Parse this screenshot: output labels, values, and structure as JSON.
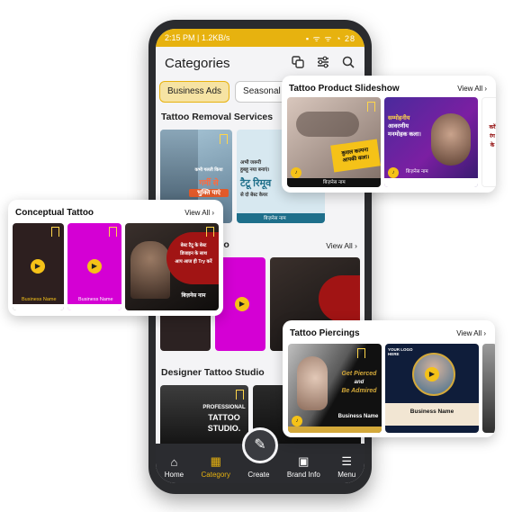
{
  "status": {
    "time": "2:15 PM | 1.2KB/s",
    "icons": "▪ ᯤ ᯤ ◔ 28"
  },
  "appbar": {
    "title": "Categories"
  },
  "chips": [
    "Business Ads",
    "Seasonal B"
  ],
  "sections": {
    "removal": "Tattoo Removal Services",
    "conceptual_partial": "ttoo",
    "designer": "Designer Tattoo Studio",
    "view_all": "View All"
  },
  "removal_posters": {
    "p1_line1": "कभी गलती किया",
    "p1_line2": "गर्मी से",
    "p1_line3": "भुक्ति पाएं",
    "p2_line1": "अभी जरूरी",
    "p2_line2": "हुबहू नया बनाएं।",
    "p2_line3": "टैटू रिमूव",
    "p2_line4": "से दो बेस्ट केयर",
    "p2_footer": "बिज़नेस नाम"
  },
  "designer_poster": {
    "line1": "PROFESSIONAL",
    "line2": "TATTOO",
    "line3": "STUDIO."
  },
  "bottom_nav": {
    "home": "Home",
    "category": "Category",
    "create": "Create",
    "brand": "Brand Info",
    "menu": "Menu"
  },
  "card_slideshow": {
    "title": "Tattoo Product Slideshow",
    "view_all": "View All",
    "p1_line1": "कुशल कल्पना",
    "p1_line2": "आपकी कला।",
    "p1_footer": "बिज़नेस नाम",
    "p2_line1": "सम्मोहनीय",
    "p2_line2": "आवरणीय",
    "p2_line3": "मनमोहक कला।",
    "p2_footer": "बिज़नेस नाम",
    "p3_line1": "करें",
    "p3_line2": "रंग",
    "p3_line3": "के"
  },
  "card_conceptual": {
    "title": "Conceptual Tattoo",
    "view_all": "View All",
    "p1_name": "Business Name",
    "p2_name": "Business Name",
    "p3_line1": "बेस्ट टैटू के बेस्ट",
    "p3_line2": "डिजाइन के साथ",
    "p3_line3": "आप आज ही Try करें",
    "p3_name": "बिज़नेस नाम"
  },
  "card_piercings": {
    "title": "Tattoo Piercings",
    "view_all": "View All",
    "p1_line1": "Get Pierced",
    "p1_line2": "and",
    "p1_line3": "Be Admired",
    "p1_name": "Business Name",
    "p2_logo": "YOUR LOGO HERE",
    "p2_name": "Business Name"
  }
}
